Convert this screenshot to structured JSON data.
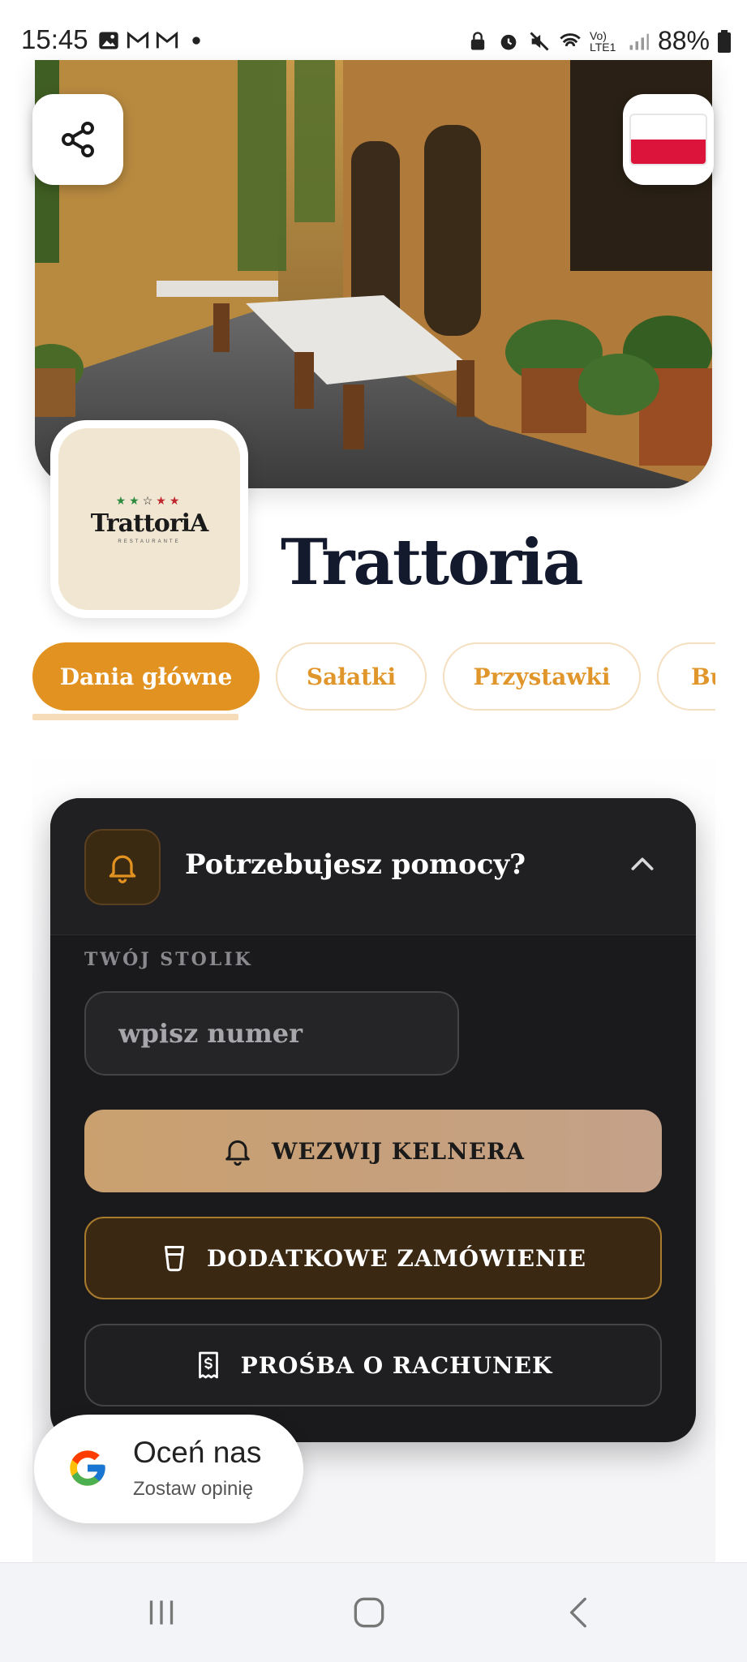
{
  "status_bar": {
    "time": "15:45",
    "battery": "88%",
    "network": "Vo) LTE1"
  },
  "restaurant": {
    "name": "Trattoria",
    "logo_word": "TrattoriA",
    "logo_sub": "RESTAURANTE"
  },
  "categories": [
    {
      "label": "Dania główne",
      "active": true
    },
    {
      "label": "Sałatki",
      "active": false
    },
    {
      "label": "Przystawki",
      "active": false
    },
    {
      "label": "Bu",
      "active": false
    }
  ],
  "help": {
    "title": "Potrzebujesz pomocy?",
    "table_label": "TWÓJ STOLIK",
    "table_placeholder": "wpisz numer",
    "call_waiter": "WEZWIJ KELNERA",
    "extra_order": "DODATKOWE ZAMÓWIENIE",
    "request_bill": "PROŚBA O RACHUNEK"
  },
  "rate_us": {
    "title": "Oceń nas",
    "subtitle": "Zostaw opinię"
  },
  "colors": {
    "accent": "#e29220",
    "panel": "#1a1a1c",
    "heading": "#141a2e",
    "flag_white": "#ffffff",
    "flag_red": "#dc143c"
  },
  "icons": [
    "share-icon",
    "poland-flag-icon",
    "bell-icon",
    "chevron-up-icon",
    "glass-icon",
    "receipt-icon",
    "google-icon",
    "recents-icon",
    "home-icon",
    "back-icon"
  ]
}
